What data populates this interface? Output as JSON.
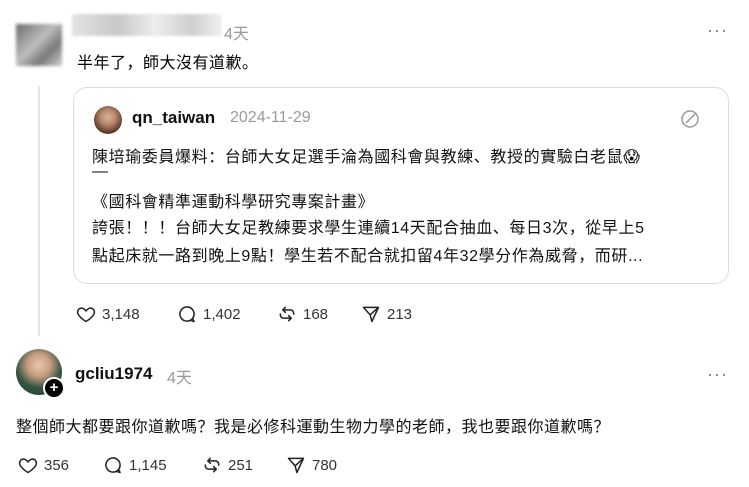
{
  "post": {
    "time": "4天",
    "text": "半年了，師大沒有道歉。",
    "more": "···"
  },
  "quote": {
    "username": "qn_taiwan",
    "date": "2024-11-29",
    "line1": "陳培瑜委員爆料：台師大女足選手淪為國科會與教練、教授的實驗白老鼠😱",
    "line2": "—",
    "line3": "《國科會精準運動科學研究專案計畫》",
    "line4": "誇張！！！台師大女足教練要求學生連續14天配合抽血、每日3次，從早上5",
    "line5": "點起床就一路到晚上9點！學生若不配合就扣留4年32學分作為威脅，而研..."
  },
  "post_actions": {
    "likes": "3,148",
    "comments": "1,402",
    "reposts": "168",
    "shares": "213"
  },
  "comment": {
    "username": "gcliu1974",
    "time": "4天",
    "more": "···",
    "text": "整個師大都要跟你道歉嗎？我是必修科運動生物力學的老師，我也要跟你道歉嗎？",
    "plus": "+"
  },
  "comment_actions": {
    "likes": "356",
    "comments": "1,145",
    "reposts": "251",
    "shares": "780"
  },
  "icons": {
    "like": "heart-icon",
    "comment": "comment-bubble-icon",
    "repost": "repost-icon",
    "share": "send-icon",
    "edit": "quote-edit-icon"
  }
}
